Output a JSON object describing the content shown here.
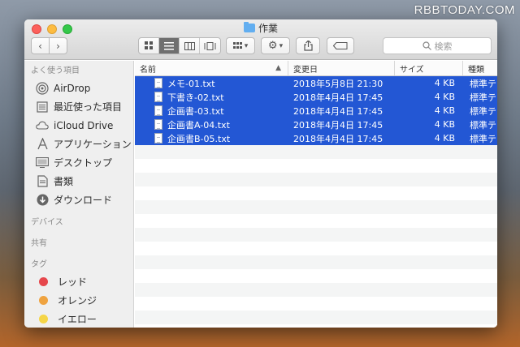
{
  "watermark": "RBBTODAY.COM",
  "window": {
    "title": "作業"
  },
  "toolbar": {
    "back_glyph": "‹",
    "forward_glyph": "›",
    "view_icons": [
      "icon-view-icon",
      "list-view-icon",
      "column-view-icon",
      "gallery-view-icon"
    ],
    "active_view": 1,
    "arrange_glyph": "▾",
    "action_glyph": "⚙",
    "share_glyph": "⇪",
    "search_placeholder": "検索"
  },
  "sidebar": {
    "favorites_label": "よく使う項目",
    "favorites": [
      {
        "label": "AirDrop",
        "icon": "airdrop-icon"
      },
      {
        "label": "最近使った項目",
        "icon": "recents-icon"
      },
      {
        "label": "iCloud Drive",
        "icon": "cloud-icon"
      },
      {
        "label": "アプリケーション",
        "icon": "applications-icon"
      },
      {
        "label": "デスクトップ",
        "icon": "desktop-icon"
      },
      {
        "label": "書類",
        "icon": "documents-icon"
      },
      {
        "label": "ダウンロード",
        "icon": "downloads-icon"
      }
    ],
    "devices_label": "デバイス",
    "shared_label": "共有",
    "tags_label": "タグ",
    "tags": [
      {
        "label": "レッド",
        "color": "#e6474c"
      },
      {
        "label": "オレンジ",
        "color": "#efa340"
      },
      {
        "label": "イエロー",
        "color": "#f5d547"
      }
    ]
  },
  "columns": {
    "name": "名前",
    "date": "変更日",
    "size": "サイズ",
    "kind": "種類"
  },
  "files": [
    {
      "name": "メモ-01.txt",
      "date": "2018年5月8日 21:30",
      "size": "4 KB",
      "kind": "標準テ"
    },
    {
      "name": "下書き-02.txt",
      "date": "2018年4月4日 17:45",
      "size": "4 KB",
      "kind": "標準テ"
    },
    {
      "name": "企画書-03.txt",
      "date": "2018年4月4日 17:45",
      "size": "4 KB",
      "kind": "標準テ"
    },
    {
      "name": "企画書A-04.txt",
      "date": "2018年4月4日 17:45",
      "size": "4 KB",
      "kind": "標準テ"
    },
    {
      "name": "企画書B-05.txt",
      "date": "2018年4月4日 17:45",
      "size": "4 KB",
      "kind": "標準テ"
    }
  ],
  "colors": {
    "selection": "#2357d4",
    "folder": "#62aef0"
  }
}
